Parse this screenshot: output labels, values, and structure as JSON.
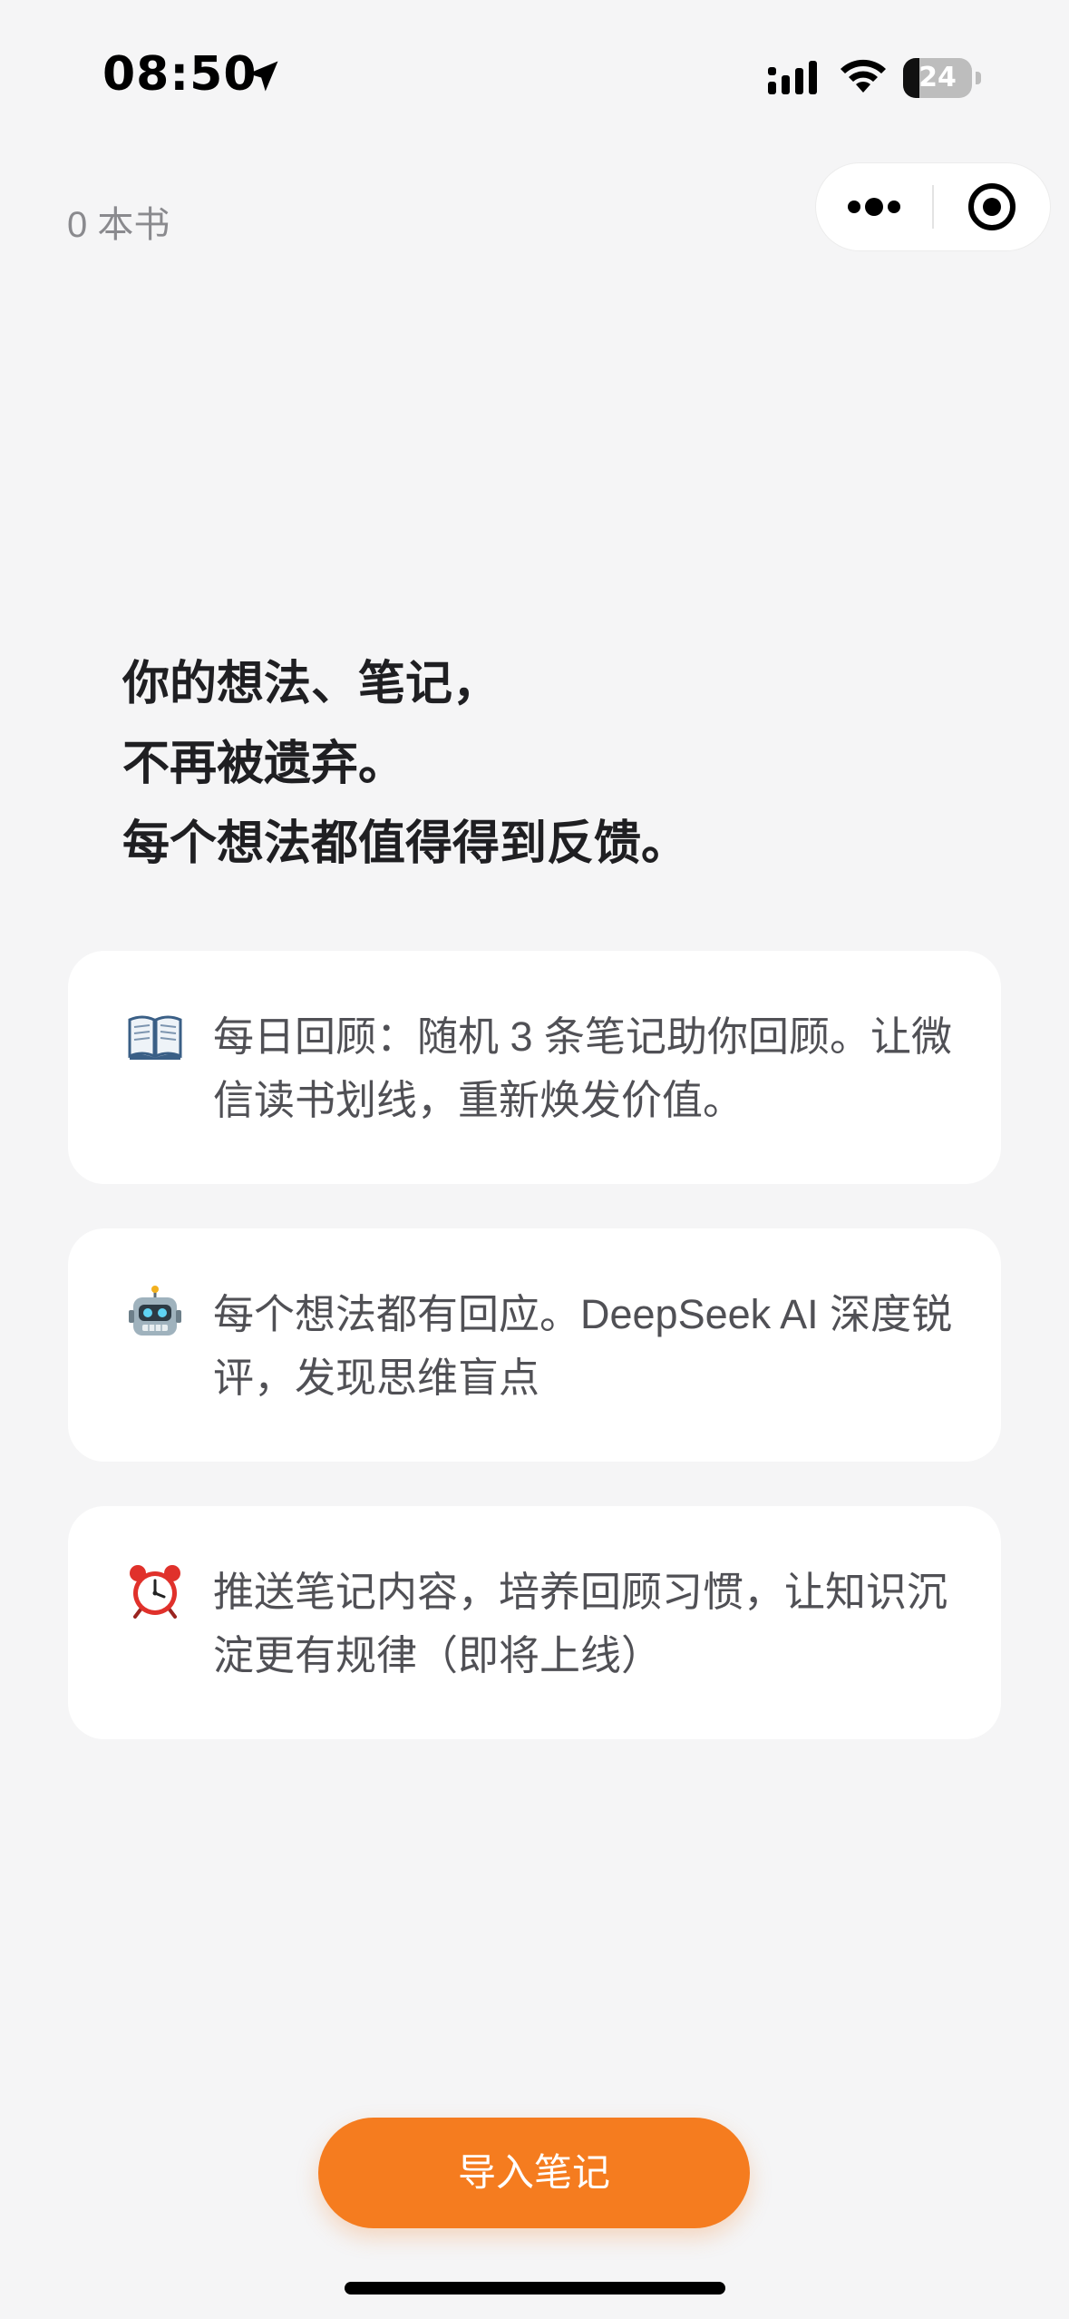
{
  "status_bar": {
    "time": "08:50",
    "battery_level": "24",
    "battery_fraction": 0.24,
    "icons": [
      "location-arrow-icon",
      "cellular-signal-icon",
      "wifi-icon",
      "battery-icon"
    ]
  },
  "header": {
    "book_count": "0 本书",
    "capsule_icons": [
      "more-dots-icon",
      "close-target-icon"
    ]
  },
  "hero": {
    "lines": [
      "你的想法、笔记，",
      "不再被遗弃。",
      "每个想法都值得得到反馈。"
    ]
  },
  "features": [
    {
      "icon": "open-book-icon",
      "text": "每日回顾：随机 3 条笔记助你回顾。让微信读书划线，重新焕发价值。"
    },
    {
      "icon": "robot-icon",
      "text": "每个想法都有回应。DeepSeek AI 深度锐评，发现思维盲点"
    },
    {
      "icon": "alarm-clock-icon",
      "text": "推送笔记内容，培养回顾习惯，让知识沉淀更有规律（即将上线）"
    }
  ],
  "actions": {
    "import_label": "导入笔记"
  },
  "colors": {
    "background": "#f5f5f6",
    "accent": "#f57c1f",
    "card": "#ffffff",
    "muted_text": "#8a8a8e"
  }
}
